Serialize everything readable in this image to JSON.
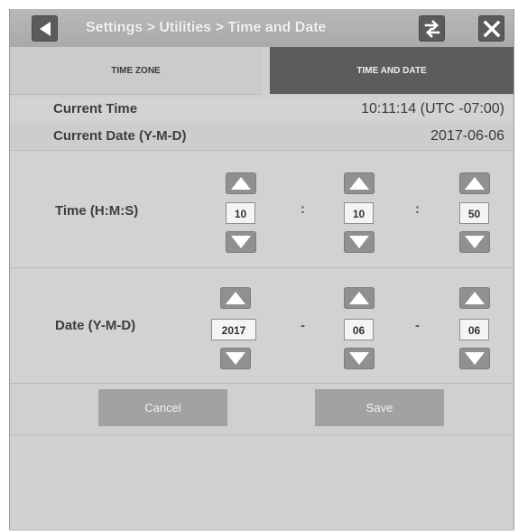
{
  "title": {
    "breadcrumb": "Settings > Utilities > Time and Date"
  },
  "tabs": [
    {
      "label": "TIME ZONE",
      "active": false
    },
    {
      "label": "TIME AND DATE",
      "active": true
    }
  ],
  "current": {
    "time_label": "Current Time",
    "time_value": "10:11:14 (UTC -07:00)",
    "date_label": "Current Date (Y-M-D)",
    "date_value": "2017-06-06"
  },
  "time_setting": {
    "label": "Time (H:M:S)",
    "hours": "10",
    "minutes": "10",
    "seconds": "50",
    "separator": ":"
  },
  "date_setting": {
    "label": "Date (Y-M-D)",
    "year": "2017",
    "month": "06",
    "day": "06",
    "separator": "-"
  },
  "actions": {
    "cancel_label": "Cancel",
    "save_label": "Save"
  },
  "colors": {
    "accent_tab": "#5c5c5c",
    "button": "#a2a2a2",
    "panel": "#cfcfcf"
  },
  "icons": {
    "back": "back-arrow-icon",
    "swap": "swap-arrows-icon",
    "close": "close-x-icon",
    "up": "triangle-up-icon",
    "down": "triangle-down-icon"
  }
}
